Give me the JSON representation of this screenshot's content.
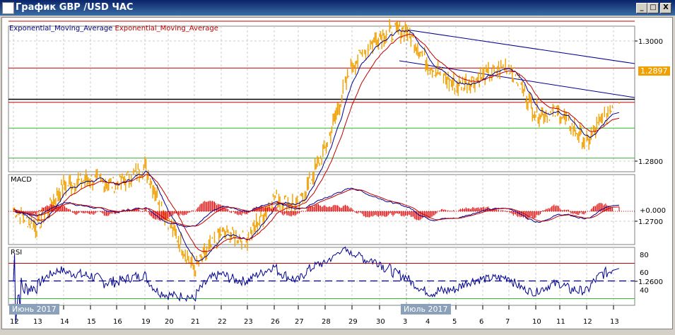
{
  "window": {
    "title": "График GBP /USD  ЧАС",
    "buttons": {
      "minimize": "_",
      "maximize": "□",
      "close": "X"
    }
  },
  "main_panel": {
    "legend": [
      {
        "text": "Exponential_Moving_Average",
        "color": "#000080"
      },
      {
        "text": "Exponential_Moving_Average",
        "color": "#c00000"
      }
    ],
    "current_price": "1.2897",
    "price_color": "#f0a000",
    "price_ticks": [
      "1.3000",
      "1.2800",
      "1.2700",
      "1.2600"
    ],
    "levels": {
      "red": [
        1.3033,
        1.2955,
        1.2898
      ],
      "black": [
        1.2903
      ],
      "green": [
        1.2855,
        1.2805
      ]
    },
    "channel": {
      "upper": [
        [
          "3",
          1.3035
        ],
        [
          "13",
          1.2922
        ]
      ],
      "lower": [
        [
          "3",
          1.2932
        ],
        [
          "13",
          1.281
        ]
      ]
    }
  },
  "macd_panel": {
    "label": "MACD",
    "zero_label": "+0.000"
  },
  "rsi_panel": {
    "label": "RSI",
    "ticks": [
      "80",
      "60",
      "40"
    ],
    "levels": {
      "overbought": 70,
      "middle": 50,
      "oversold": 30
    }
  },
  "x_axis": {
    "dates": [
      "12",
      "13",
      "14",
      "15",
      "16",
      "19",
      "20",
      "21",
      "22",
      "23",
      "26",
      "27",
      "28",
      "29",
      "30",
      "3",
      "4",
      "5",
      "6",
      "7",
      "10",
      "11",
      "12",
      "13"
    ],
    "month_labels": [
      {
        "text": "Июнь 2017",
        "at": "12"
      },
      {
        "text": "Июль 2017",
        "at": "3"
      }
    ]
  },
  "chart_data": {
    "type": "line",
    "title": "График GBP /USD  ЧАС",
    "x": [
      "12",
      "13",
      "14",
      "15",
      "16",
      "19",
      "20",
      "21",
      "22",
      "23",
      "26",
      "27",
      "28",
      "29",
      "30",
      "3",
      "4",
      "5",
      "6",
      "7",
      "10",
      "11",
      "12",
      "13"
    ],
    "series": [
      {
        "name": "GBP/USD",
        "values": [
          1.272,
          1.269,
          1.276,
          1.277,
          1.276,
          1.279,
          1.27,
          1.262,
          1.268,
          1.267,
          1.274,
          1.2725,
          1.282,
          1.296,
          1.301,
          1.302,
          1.296,
          1.2925,
          1.294,
          1.296,
          1.288,
          1.288,
          1.283,
          1.2897
        ]
      }
    ],
    "ylim": [
      1.256,
      1.304
    ],
    "rsi_ylim": [
      20,
      90
    ]
  }
}
